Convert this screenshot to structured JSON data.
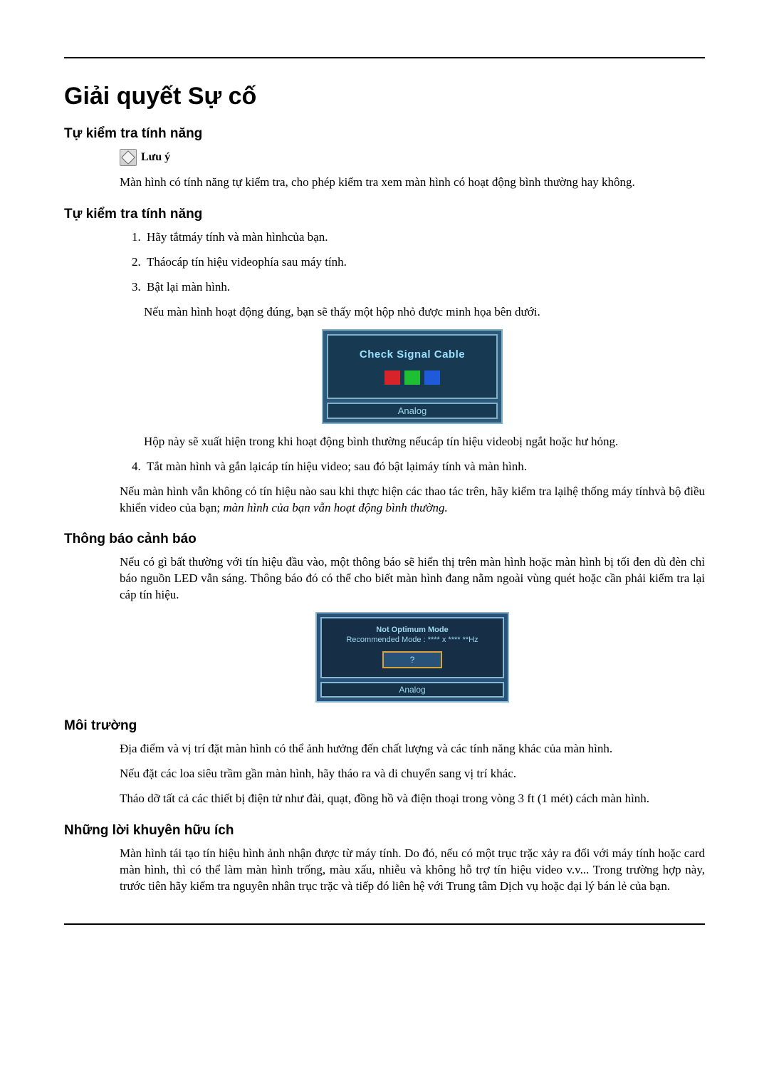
{
  "title": "Giải quyết Sự cố",
  "section1": {
    "heading": "Tự kiểm tra tính năng",
    "note_label": "Lưu ý",
    "paragraph": "Màn hình có tính năng tự kiểm tra, cho phép kiểm tra xem màn hình có hoạt động bình thường hay không."
  },
  "section2": {
    "heading": "Tự kiểm tra tính năng",
    "steps": [
      "Hãy tắtmáy tính và màn hìnhcủa bạn.",
      "Tháocáp tín hiệu videophía sau máy tính.",
      "Bật lại màn hình."
    ],
    "after_step3": "Nếu màn hình hoạt động đúng, bạn sẽ thấy một hộp nhỏ được minh họa bên dưới.",
    "signal_box": {
      "title": "Check Signal Cable",
      "footer": "Analog"
    },
    "after_box": "Hộp này sẽ xuất hiện trong khi hoạt động bình thường nếucáp tín hiệu videobị ngắt hoặc hư hỏng.",
    "step4": "Tắt màn hình và gắn lạicáp tín hiệu video; sau đó bật lạimáy tính và màn hình.",
    "closing_a": "Nếu màn hình vẫn không có tín hiệu nào sau khi thực hiện các thao tác trên, hãy kiểm tra lạihệ thống máy tínhvà bộ điều khiển video của bạn; ",
    "closing_b": "màn hình của bạn vẫn hoạt động bình thường."
  },
  "section3": {
    "heading": "Thông báo cảnh báo",
    "paragraph": "Nếu có gì bất thường với tín hiệu đầu vào, một thông báo sẽ hiển thị trên màn hình hoặc màn hình bị tối đen dù đèn chỉ báo nguồn LED vẫn sáng. Thông báo đó có thể cho biết màn hình đang nằm ngoài vùng quét hoặc cần phải kiểm tra lại cáp tín hiệu.",
    "warn_box": {
      "line1": "Not Optimum Mode",
      "line2": "Recommended Mode : **** x ****  **Hz",
      "button": "?",
      "footer": "Analog"
    }
  },
  "section4": {
    "heading": "Môi trường",
    "p1": "Địa điểm và vị trí đặt màn hình có thể ảnh hưởng đến chất lượng và các tính năng khác của màn hình.",
    "p2": "Nếu đặt các loa siêu trầm gần màn hình, hãy tháo ra và di chuyển sang vị trí khác.",
    "p3": "Tháo dỡ tất cả các thiết bị điện tử như đài, quạt, đồng hồ và điện thoại trong vòng 3 ft (1 mét) cách màn hình."
  },
  "section5": {
    "heading": "Những lời khuyên hữu ích",
    "paragraph": "Màn hình tái tạo tín hiệu hình ảnh nhận được từ máy tính. Do đó, nếu có một trục trặc xảy ra đối với máy tính hoặc card màn hình, thì có thể làm màn hình trống, màu xấu, nhiễu và không hỗ trợ tín hiệu video v.v... Trong trường hợp này, trước tiên hãy kiểm tra nguyên nhân trục trặc và tiếp đó liên hệ với Trung tâm Dịch vụ hoặc đại lý bán lẻ của bạn."
  }
}
